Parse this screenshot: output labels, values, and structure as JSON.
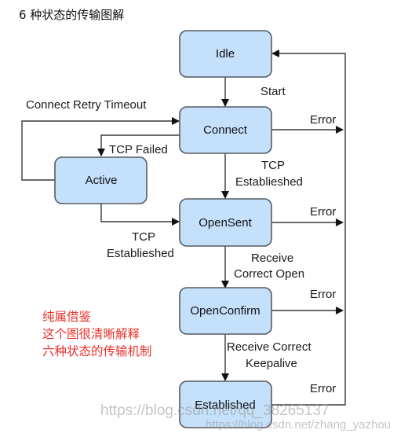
{
  "title": "6 种状态的传输图解",
  "states": {
    "idle": "Idle",
    "connect": "Connect",
    "active": "Active",
    "opensent": "OpenSent",
    "openconfirm": "OpenConfirm",
    "established": "Established"
  },
  "transitions": {
    "start": "Start",
    "connect_retry_timeout": "Connect Retry Timeout",
    "tcp_failed": "TCP Failed",
    "tcp_established_1a": "TCP",
    "tcp_established_1b": "Establieshed",
    "tcp_established_2a": "TCP",
    "tcp_established_2b": "Establieshed",
    "receive_open_a": "Receive",
    "receive_open_b": "Correct Open",
    "receive_keepalive_a": "Receive Correct",
    "receive_keepalive_b": "Keepalive",
    "error_connect": "Error",
    "error_opensent": "Error",
    "error_openconfirm": "Error",
    "error_established": "Error"
  },
  "note": {
    "line1": "纯属借鉴",
    "line2": "这个图很清晰解释",
    "line3": "六种状态的传输机制"
  },
  "watermarks": {
    "wm1": "https://blog.csdn.net/qq_38265137",
    "wm2": "https://blog.csdn.net/zhang_yazhou"
  }
}
